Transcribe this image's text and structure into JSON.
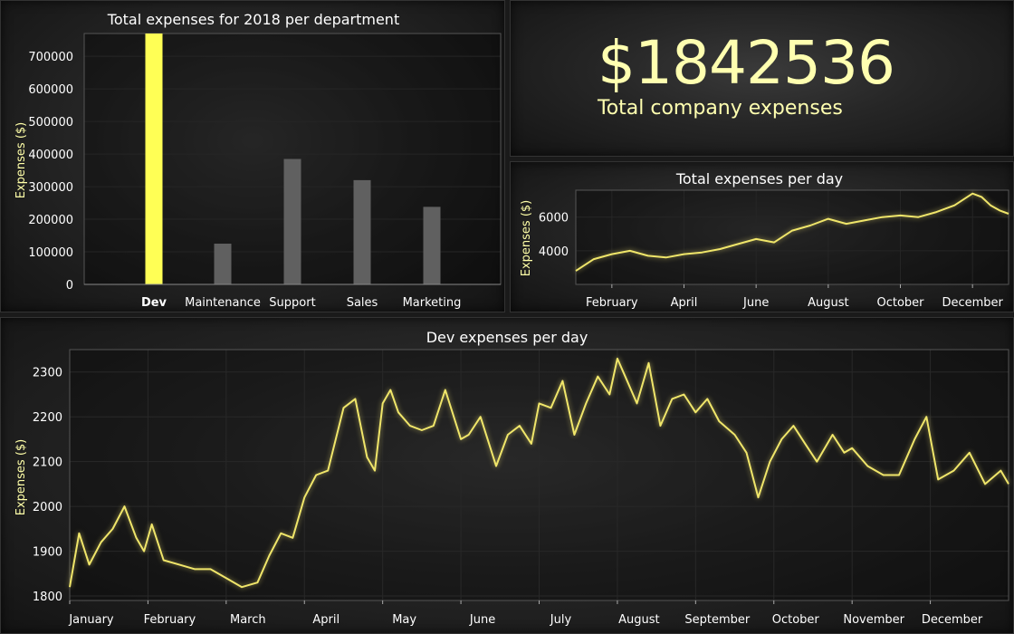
{
  "summary": {
    "amount": "$1842536",
    "label": "Total company expenses"
  },
  "colors": {
    "accent": "#ffff55",
    "line": "#f0e66a",
    "bar": "#606060",
    "grid": "#3a3a3a",
    "text": "#ffffff",
    "ylabel": "#ffffa8"
  },
  "chart_data": [
    {
      "id": "dept",
      "type": "bar",
      "title": "Total expenses for 2018 per department",
      "xlabel": "",
      "ylabel": "Expenses ($)",
      "categories": [
        "Dev",
        "Maintenance",
        "Support",
        "Sales",
        "Marketing"
      ],
      "values": [
        770000,
        125000,
        385000,
        320000,
        238000
      ],
      "highlight": "Dev",
      "ylim": [
        0,
        770000
      ],
      "yticks": [
        0,
        100000,
        200000,
        300000,
        400000,
        500000,
        600000,
        700000
      ],
      "grid": true,
      "legend": "none"
    },
    {
      "id": "day",
      "type": "line",
      "title": "Total expenses per day",
      "xlabel": "",
      "ylabel": "Expenses ($)",
      "x_unit": "month index (Jan = 0)",
      "x_range": [
        0,
        12
      ],
      "xticks": [
        {
          "x": 1,
          "label": "February"
        },
        {
          "x": 3,
          "label": "April"
        },
        {
          "x": 5,
          "label": "June"
        },
        {
          "x": 7,
          "label": "August"
        },
        {
          "x": 9,
          "label": "October"
        },
        {
          "x": 11,
          "label": "December"
        }
      ],
      "ylim": [
        2000,
        7600
      ],
      "yticks": [
        4000,
        6000
      ],
      "series": [
        {
          "x": [
            0,
            0.5,
            1,
            1.5,
            2,
            2.5,
            3,
            3.5,
            4,
            4.5,
            5,
            5.5,
            6,
            6.5,
            7,
            7.5,
            8,
            8.5,
            9,
            9.5,
            10,
            10.5,
            11,
            11.25,
            11.5,
            11.75,
            12
          ],
          "values": [
            2800,
            3500,
            3800,
            4000,
            3700,
            3600,
            3800,
            3900,
            4100,
            4400,
            4700,
            4500,
            5200,
            5500,
            5900,
            5600,
            5800,
            6000,
            6100,
            6000,
            6300,
            6700,
            7400,
            7200,
            6700,
            6400,
            6200
          ]
        }
      ],
      "grid": true,
      "legend": "none"
    },
    {
      "id": "dev",
      "type": "line",
      "title": "Dev expenses per day",
      "xlabel": "",
      "ylabel": "Expenses ($)",
      "x_unit": "month index (Jan = 0)",
      "x_range": [
        0,
        12
      ],
      "xticks": [
        {
          "x": 0,
          "label": "January"
        },
        {
          "x": 1,
          "label": "February"
        },
        {
          "x": 2,
          "label": "March"
        },
        {
          "x": 3,
          "label": "April"
        },
        {
          "x": 4,
          "label": "May"
        },
        {
          "x": 5,
          "label": "June"
        },
        {
          "x": 6,
          "label": "July"
        },
        {
          "x": 7,
          "label": "August"
        },
        {
          "x": 8,
          "label": "September"
        },
        {
          "x": 9,
          "label": "October"
        },
        {
          "x": 10,
          "label": "November"
        },
        {
          "x": 11,
          "label": "December"
        }
      ],
      "ylim": [
        1790,
        2350
      ],
      "yticks": [
        1800,
        1900,
        2000,
        2100,
        2200,
        2300
      ],
      "series": [
        {
          "x": [
            0,
            0.12,
            0.25,
            0.4,
            0.55,
            0.7,
            0.85,
            0.95,
            1.05,
            1.2,
            1.4,
            1.6,
            1.8,
            2.0,
            2.2,
            2.4,
            2.55,
            2.7,
            2.85,
            3.0,
            3.15,
            3.3,
            3.5,
            3.65,
            3.8,
            3.9,
            4.0,
            4.1,
            4.2,
            4.35,
            4.5,
            4.65,
            4.8,
            5.0,
            5.1,
            5.25,
            5.45,
            5.6,
            5.75,
            5.9,
            6.0,
            6.15,
            6.3,
            6.45,
            6.6,
            6.75,
            6.9,
            7.0,
            7.1,
            7.25,
            7.4,
            7.55,
            7.7,
            7.85,
            8.0,
            8.15,
            8.3,
            8.5,
            8.65,
            8.8,
            8.95,
            9.1,
            9.25,
            9.4,
            9.55,
            9.75,
            9.9,
            10.0,
            10.2,
            10.4,
            10.6,
            10.8,
            10.95,
            11.1,
            11.3,
            11.5,
            11.7,
            11.9,
            12.0
          ],
          "values": [
            1820,
            1940,
            1870,
            1920,
            1950,
            2000,
            1930,
            1900,
            1960,
            1880,
            1870,
            1860,
            1860,
            1840,
            1820,
            1830,
            1890,
            1940,
            1930,
            2020,
            2070,
            2080,
            2220,
            2240,
            2110,
            2080,
            2230,
            2260,
            2210,
            2180,
            2170,
            2180,
            2260,
            2150,
            2160,
            2200,
            2090,
            2160,
            2180,
            2140,
            2230,
            2220,
            2280,
            2160,
            2230,
            2290,
            2250,
            2330,
            2290,
            2230,
            2320,
            2180,
            2240,
            2250,
            2210,
            2240,
            2190,
            2160,
            2120,
            2020,
            2100,
            2150,
            2180,
            2140,
            2100,
            2160,
            2120,
            2130,
            2090,
            2070,
            2070,
            2150,
            2200,
            2060,
            2080,
            2120,
            2050,
            2080,
            2050
          ]
        }
      ],
      "grid": true,
      "legend": "none"
    }
  ]
}
